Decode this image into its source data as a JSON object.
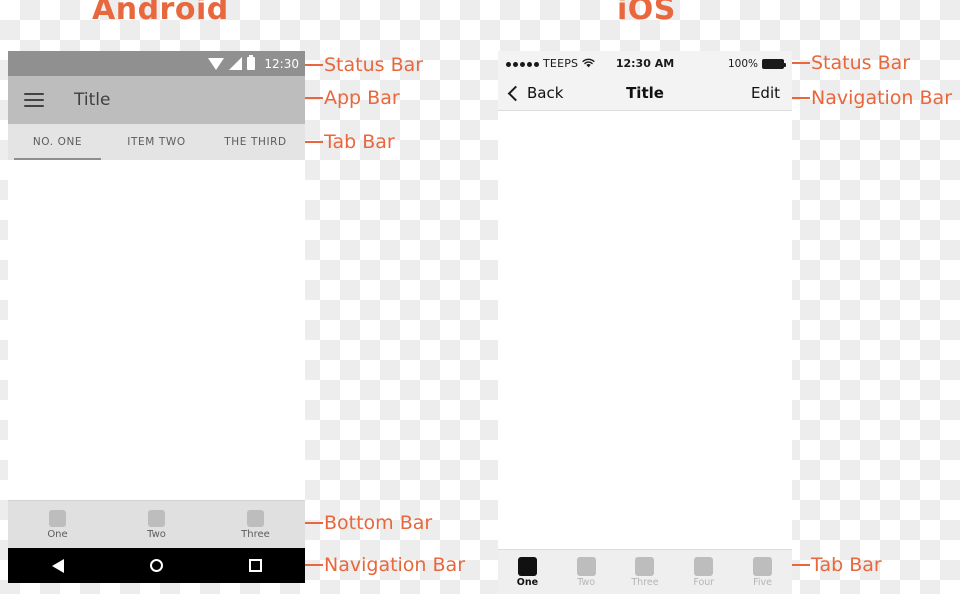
{
  "headings": {
    "android": "Android",
    "ios": "iOS"
  },
  "accent_color": "#e8673c",
  "android": {
    "status_bar": {
      "time": "12:30",
      "icons": [
        "wifi-icon",
        "signal-icon",
        "battery-icon"
      ]
    },
    "app_bar": {
      "menu_icon": "hamburger-menu-icon",
      "title": "Title"
    },
    "tab_bar": {
      "tabs": [
        {
          "label": "NO. ONE",
          "active": true
        },
        {
          "label": "ITEM TWO",
          "active": false
        },
        {
          "label": "THE THIRD",
          "active": false
        }
      ]
    },
    "bottom_bar": {
      "items": [
        {
          "label": "One"
        },
        {
          "label": "Two"
        },
        {
          "label": "Three"
        }
      ]
    },
    "navigation_bar": {
      "buttons": [
        "back-icon",
        "home-icon",
        "recents-icon"
      ]
    }
  },
  "ios": {
    "status_bar": {
      "signal_dots": 5,
      "carrier": "TEEPS",
      "wifi_icon": "wifi-icon",
      "time": "12:30 AM",
      "battery_percent": "100%",
      "battery_icon": "battery-icon"
    },
    "navigation_bar": {
      "back_label": "Back",
      "back_icon": "chevron-left-icon",
      "title": "Title",
      "right_action": "Edit"
    },
    "tab_bar": {
      "items": [
        {
          "label": "One",
          "active": true
        },
        {
          "label": "Two",
          "active": false
        },
        {
          "label": "Three",
          "active": false
        },
        {
          "label": "Four",
          "active": false
        },
        {
          "label": "Five",
          "active": false
        }
      ]
    }
  },
  "annotations": {
    "android_status_bar": "Status Bar",
    "android_app_bar": "App Bar",
    "android_tab_bar": "Tab Bar",
    "android_bottom_bar": "Bottom Bar",
    "android_navigation_bar": "Navigation Bar",
    "ios_status_bar": "Status Bar",
    "ios_navigation_bar": "Navigation Bar",
    "ios_tab_bar": "Tab Bar"
  }
}
